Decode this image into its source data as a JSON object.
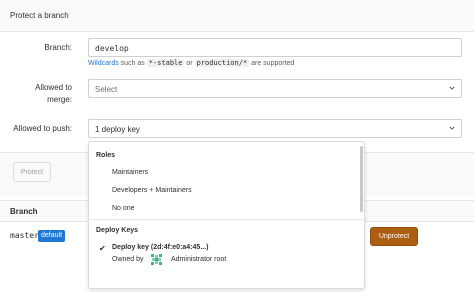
{
  "protect_panel": {
    "title": "Protect a branch",
    "branch_label": "Branch:",
    "branch_value": "develop",
    "help": {
      "link": "Wildcards",
      "text1": " such as ",
      "code1": "*-stable",
      "text2": " or ",
      "code2": "production/*",
      "text3": " are supported"
    },
    "merge_label_line1": "Allowed to",
    "merge_label_line2": "merge:",
    "merge_placeholder": "Select",
    "push_label": "Allowed to push:",
    "push_value": "1 deploy key",
    "protect_button": "Protect"
  },
  "dropdown": {
    "roles_header": "Roles",
    "roles": [
      "Maintainers",
      "Developers + Maintainers",
      "No one"
    ],
    "deploy_keys_header": "Deploy Keys",
    "deploy_key": {
      "check": "✔",
      "name": "Deploy key (2d:4f:e0:a4:45...)",
      "owned_by": "Owned by",
      "owner": "Administrator root"
    }
  },
  "table": {
    "header": "Branch",
    "rows": [
      {
        "branch": "master",
        "badge": "default",
        "action": "Unprotect"
      }
    ]
  },
  "colors": {
    "link": "#1f78d1",
    "badge": "#1f78d1",
    "unprotect": "#ad5f11"
  }
}
